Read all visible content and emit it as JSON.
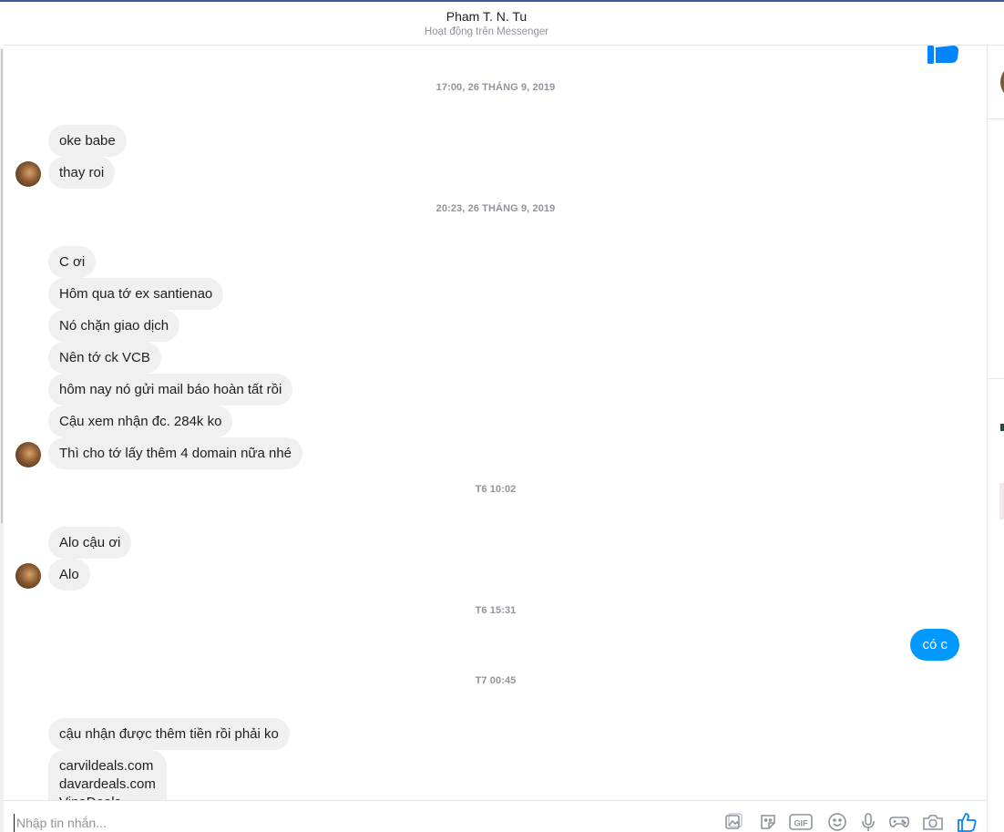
{
  "header": {
    "name": "Pham T. N. Tu",
    "status": "Hoạt động trên Messenger"
  },
  "messages": {
    "ts1": "17:00, 26 THÁNG 9, 2019",
    "m1": "oke babe",
    "m2": "thay roi",
    "ts2": "20:23, 26 THÁNG 9, 2019",
    "m3": "C ơi",
    "m4": "Hôm qua tớ ex santienao",
    "m5": "Nó chặn giao dịch",
    "m6": "Nên tớ ck VCB",
    "m7": "hôm nay nó gửi mail báo hoàn tất rồi",
    "m8": "Cậu xem nhận đc. 284k ko",
    "m9": "Thì cho tớ lấy thêm 4 domain nữa nhé",
    "ts3": "T6 10:02",
    "m10": "Alo cậu ơi",
    "m11": "Alo",
    "ts4": "T6 15:31",
    "out1": "có c",
    "ts5": "T7 00:45",
    "m12": "cậu nhận được thêm tiền rồi phải ko",
    "m13": "carvildeals.com\ndavardeals.com\nVinaDeals..."
  },
  "composer": {
    "placeholder": "Nhập tin nhắn..."
  },
  "colors": {
    "accent": "#0099ff",
    "incoming_bubble": "#f0f0f0",
    "timestamp": "#90949c"
  }
}
